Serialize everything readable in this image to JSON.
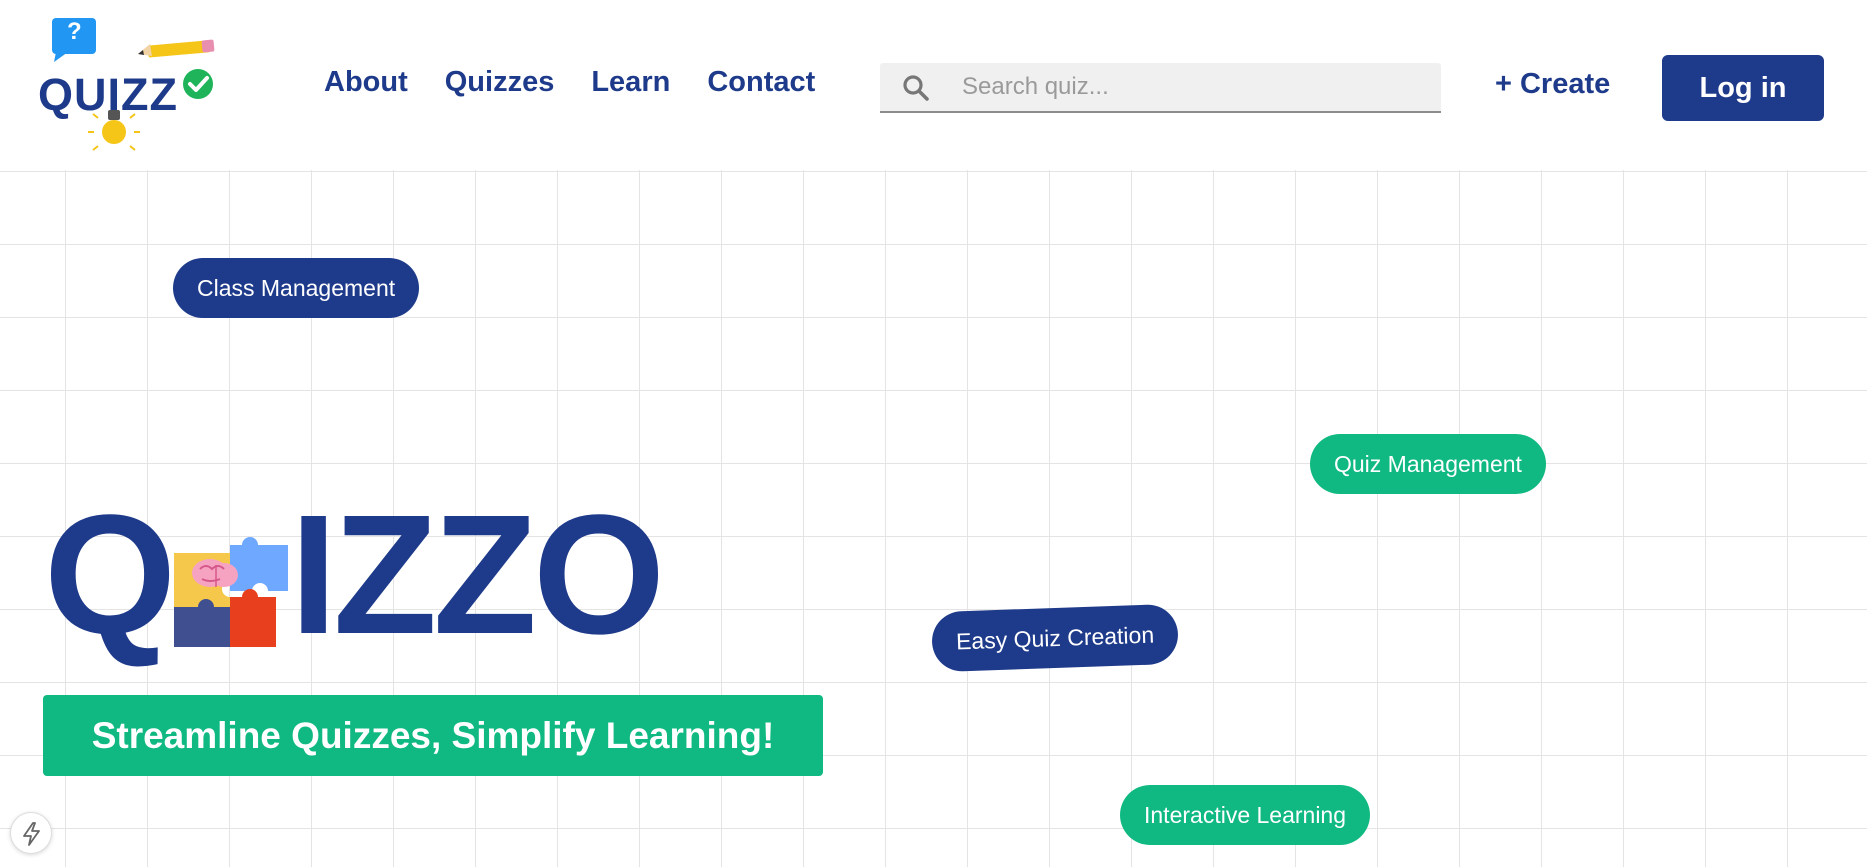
{
  "header": {
    "logo": {
      "wordmark": "QUIZZ",
      "question_mark": "?",
      "icons": [
        "speech-bubble-question-icon",
        "pencil-icon",
        "check-circle-icon",
        "lightbulb-icon"
      ]
    },
    "nav": [
      {
        "label": "About"
      },
      {
        "label": "Quizzes"
      },
      {
        "label": "Learn"
      },
      {
        "label": "Contact"
      }
    ],
    "search": {
      "placeholder": "Search quiz...",
      "value": "",
      "icon": "search-icon"
    },
    "create_label": "+ Create",
    "login_label": "Log in"
  },
  "hero": {
    "pills": [
      {
        "label": "Class Management"
      },
      {
        "label": "Quiz Management"
      },
      {
        "label": "Easy Quiz Creation"
      },
      {
        "label": "Interactive Learning"
      }
    ],
    "title_first": "Q",
    "title_rest": "IZZO",
    "title_icon": "puzzle-brain-icon",
    "tagline": "Streamline Quizzes, Simplify Learning!"
  },
  "floating": {
    "icon": "lightning-bolt-icon"
  },
  "colors": {
    "primary": "#1e3a8a",
    "accent": "#10b981",
    "grid_line": "#e4e4e4",
    "search_bg": "#f0f0f0"
  }
}
